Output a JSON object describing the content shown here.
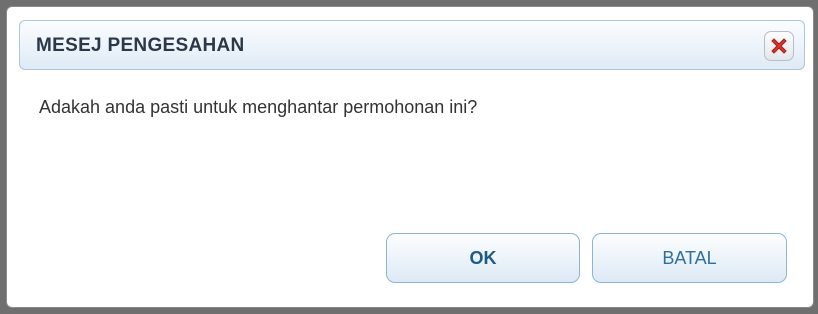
{
  "dialog": {
    "title": "MESEJ PENGESAHAN",
    "message": "Adakah anda pasti untuk menghantar permohonan ini?",
    "close_icon": "close-x-icon",
    "ok_label": "OK",
    "cancel_label": "BATAL"
  },
  "colors": {
    "title_text": "#2b3848",
    "button_text": "#1d5b86",
    "border_accent": "#8db4d4",
    "close_icon": "#d9352a"
  }
}
